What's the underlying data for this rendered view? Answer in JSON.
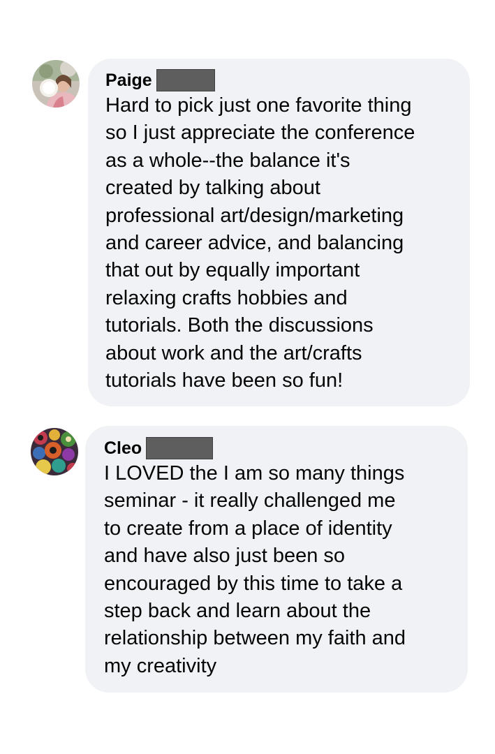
{
  "comments": [
    {
      "author": "Paige",
      "author_surname_redacted": true,
      "avatar_icon": "profile-photo-icon",
      "text": "Hard to pick just one favorite thing\nso I just appreciate the conference\nas a whole--the balance it's\ncreated by talking about\nprofessional art/design/marketing\nand career advice, and balancing\nthat out by equally important\nrelaxing crafts hobbies and\ntutorials. Both the discussions\nabout work and the art/crafts\ntutorials have been so fun!"
    },
    {
      "author": "Cleo",
      "author_surname_redacted": true,
      "avatar_icon": "profile-photo-icon",
      "text": "I LOVED the I am so many things\nseminar - it really challenged me\nto create from a place of identity\nand have also just been so\nencouraged by this time to take a\nstep back and learn about the\nrelationship between my faith and\nmy creativity"
    }
  ],
  "colors": {
    "bubble_background": "#f0f2f5",
    "text": "#050505",
    "redaction": "#5e5e5e"
  }
}
